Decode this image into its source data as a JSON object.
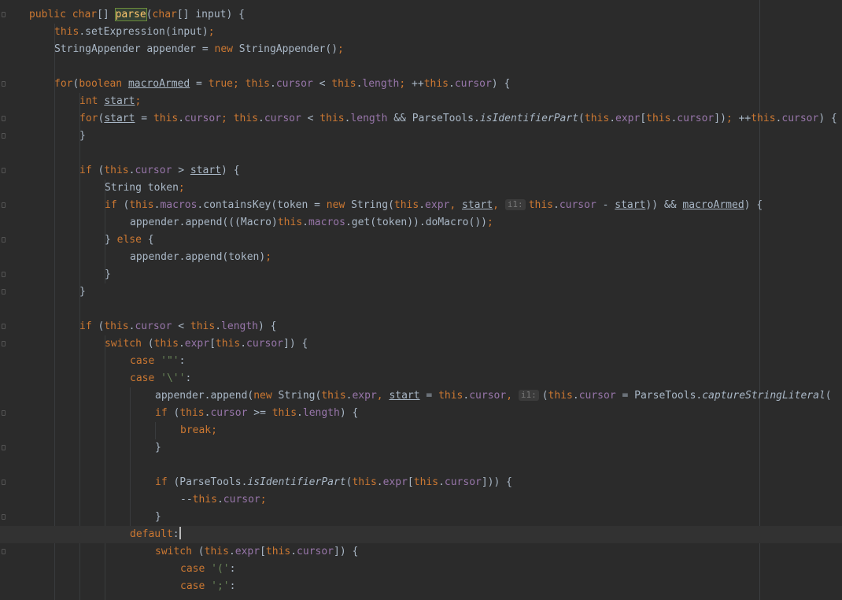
{
  "editor": {
    "param_hint_label": "i1:",
    "lines": [
      "public char[] parse(char[] input) {",
      "this.setExpression(input);",
      "StringAppender appender = new StringAppender();",
      "",
      "for(boolean macroArmed = true; this.cursor < this.length; ++this.cursor) {",
      "int start;",
      "for(start = this.cursor; this.cursor < this.length && ParseTools.isIdentifierPart(this.expr[this.cursor]); ++this.cursor) {",
      "}",
      "",
      "if (this.cursor > start) {",
      "String token;",
      "if (this.macros.containsKey(token = new String(this.expr, start, this.cursor - start)) && macroArmed) {",
      "appender.append(((Macro)this.macros.get(token)).doMacro());",
      "} else {",
      "appender.append(token);",
      "}",
      "}",
      "",
      "if (this.cursor < this.length) {",
      "switch (this.expr[this.cursor]) {",
      "case '\"':",
      "case '\\'':",
      "appender.append(new String(this.expr, start = this.cursor, (this.cursor = ParseTools.captureStringLiteral(",
      "if (this.cursor >= this.length) {",
      "break;",
      "}",
      "",
      "if (ParseTools.isIdentifierPart(this.expr[this.cursor])) {",
      "--this.cursor;",
      "}",
      "default:",
      "switch (this.expr[this.cursor]) {",
      "case '(':",
      "case ';':"
    ]
  }
}
